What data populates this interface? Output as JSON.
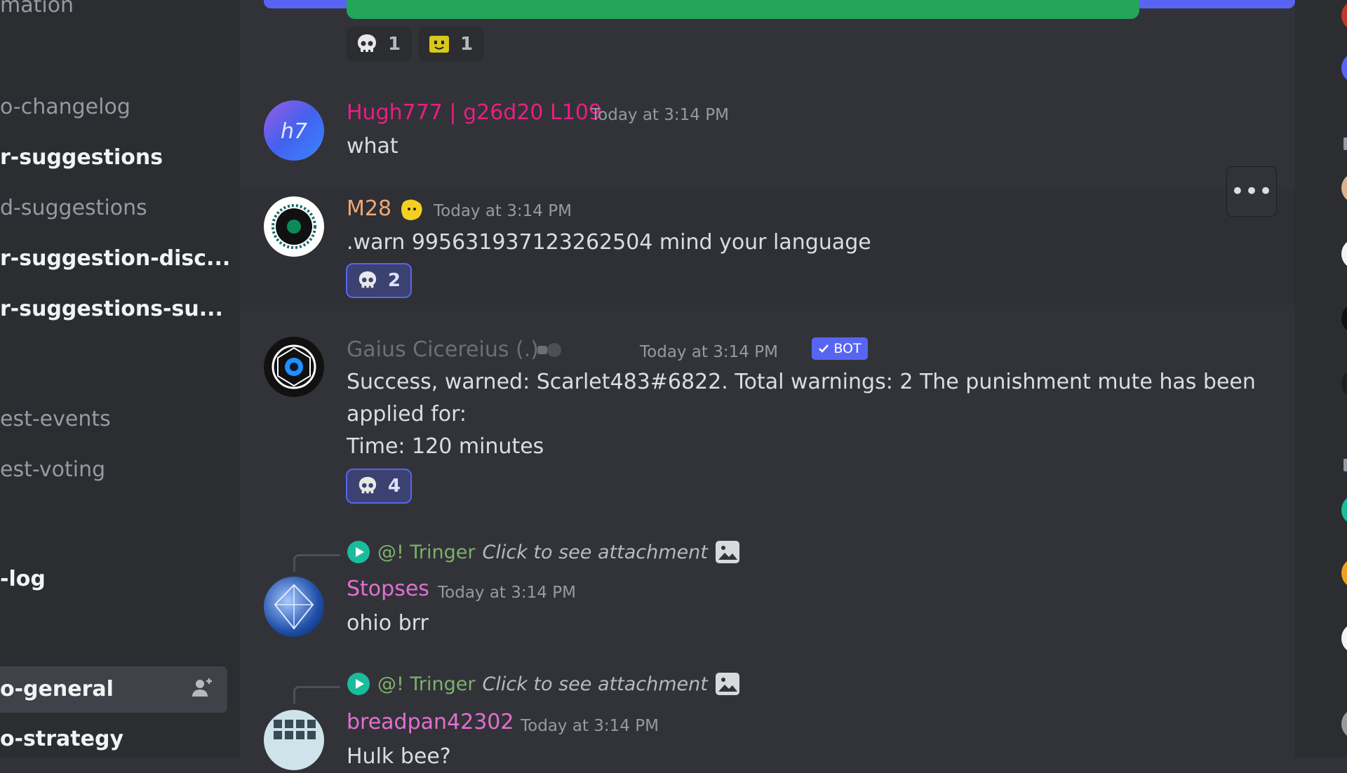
{
  "sidebar": {
    "channels": [
      {
        "label": "mation",
        "state": "normal"
      },
      {
        "label": "o-changelog",
        "state": "normal"
      },
      {
        "label": "r-suggestions",
        "state": "unread"
      },
      {
        "label": "d-suggestions",
        "state": "normal"
      },
      {
        "label": "r-suggestion-disc...",
        "state": "unread"
      },
      {
        "label": "r-suggestions-su...",
        "state": "unread"
      },
      {
        "label": "est-events",
        "state": "normal"
      },
      {
        "label": "est-voting",
        "state": "normal"
      },
      {
        "label": "-log",
        "state": "unread"
      },
      {
        "label": "o-general",
        "state": "active"
      },
      {
        "label": "o-strategy",
        "state": "unread"
      }
    ]
  },
  "top_reactions": [
    {
      "emoji": "skull",
      "count": "1"
    },
    {
      "emoji": "yellow-face",
      "count": "1"
    }
  ],
  "messages": [
    {
      "author": "Hugh777 | g26d20 L109",
      "author_color": "#e91e84",
      "timestamp": "Today at 3:14 PM",
      "lines": [
        "what"
      ]
    },
    {
      "author": "M28",
      "author_color": "#f0a875",
      "timestamp": "Today at 3:14 PM",
      "lines": [
        ".warn 995631937123262504 mind your language"
      ],
      "reactions": [
        {
          "emoji": "skull",
          "count": "2",
          "reacted": true
        }
      ]
    },
    {
      "author": "Gaius Cicereius (.)",
      "author_color": "#6d6f78",
      "badge": "BOT",
      "timestamp": "Today at 3:14 PM",
      "lines": [
        "Success, warned: Scarlet483#6822. Total warnings: 2 The punishment mute has been",
        "applied for:",
        "Time: 120 minutes"
      ],
      "reactions": [
        {
          "emoji": "skull",
          "count": "4",
          "reacted": true
        }
      ]
    },
    {
      "reply": {
        "name": "@! Tringer",
        "text": "Click to see attachment"
      },
      "author": "Stopses",
      "author_color": "#e36fd0",
      "timestamp": "Today at 3:14 PM",
      "lines": [
        "ohio brr"
      ]
    },
    {
      "reply": {
        "name": "@! Tringer",
        "text": "Click to see attachment"
      },
      "author": "breadpan42302",
      "author_color": "#e36fd0",
      "timestamp": "Today at 3:14 PM",
      "lines": [
        "Hulk bee?"
      ]
    }
  ],
  "colors": {
    "accent": "#5865f2",
    "green": "#23a55a",
    "bg": "#313338",
    "sidebar": "#2b2d31"
  },
  "icons": [
    "skull-icon",
    "more-options-icon",
    "add-member-icon",
    "image-attachment-icon",
    "bot-verified-icon"
  ]
}
